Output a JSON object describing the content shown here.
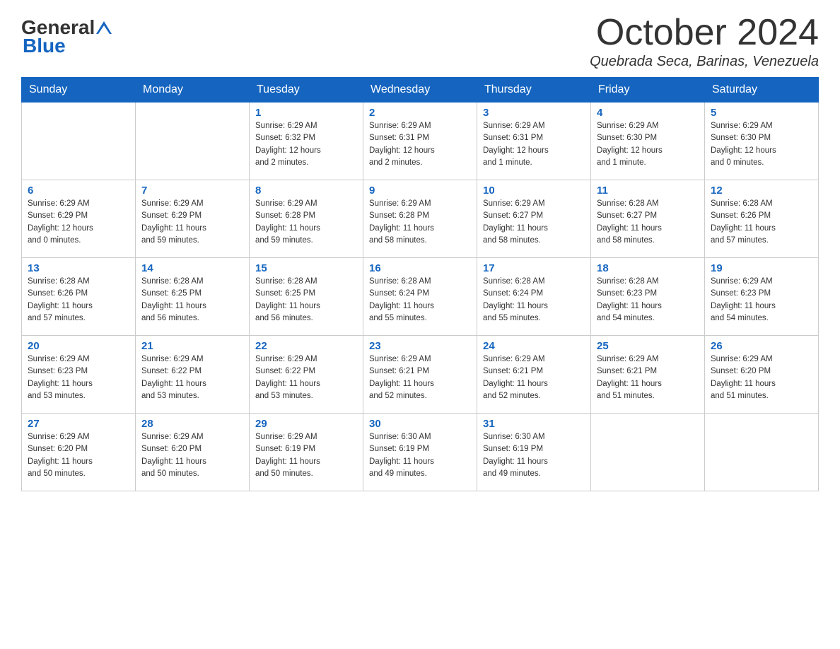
{
  "header": {
    "logo_general": "General",
    "logo_blue": "Blue",
    "month_title": "October 2024",
    "location": "Quebrada Seca, Barinas, Venezuela"
  },
  "days_of_week": [
    "Sunday",
    "Monday",
    "Tuesday",
    "Wednesday",
    "Thursday",
    "Friday",
    "Saturday"
  ],
  "weeks": [
    [
      {
        "day": "",
        "info": ""
      },
      {
        "day": "",
        "info": ""
      },
      {
        "day": "1",
        "info": "Sunrise: 6:29 AM\nSunset: 6:32 PM\nDaylight: 12 hours\nand 2 minutes."
      },
      {
        "day": "2",
        "info": "Sunrise: 6:29 AM\nSunset: 6:31 PM\nDaylight: 12 hours\nand 2 minutes."
      },
      {
        "day": "3",
        "info": "Sunrise: 6:29 AM\nSunset: 6:31 PM\nDaylight: 12 hours\nand 1 minute."
      },
      {
        "day": "4",
        "info": "Sunrise: 6:29 AM\nSunset: 6:30 PM\nDaylight: 12 hours\nand 1 minute."
      },
      {
        "day": "5",
        "info": "Sunrise: 6:29 AM\nSunset: 6:30 PM\nDaylight: 12 hours\nand 0 minutes."
      }
    ],
    [
      {
        "day": "6",
        "info": "Sunrise: 6:29 AM\nSunset: 6:29 PM\nDaylight: 12 hours\nand 0 minutes."
      },
      {
        "day": "7",
        "info": "Sunrise: 6:29 AM\nSunset: 6:29 PM\nDaylight: 11 hours\nand 59 minutes."
      },
      {
        "day": "8",
        "info": "Sunrise: 6:29 AM\nSunset: 6:28 PM\nDaylight: 11 hours\nand 59 minutes."
      },
      {
        "day": "9",
        "info": "Sunrise: 6:29 AM\nSunset: 6:28 PM\nDaylight: 11 hours\nand 58 minutes."
      },
      {
        "day": "10",
        "info": "Sunrise: 6:29 AM\nSunset: 6:27 PM\nDaylight: 11 hours\nand 58 minutes."
      },
      {
        "day": "11",
        "info": "Sunrise: 6:28 AM\nSunset: 6:27 PM\nDaylight: 11 hours\nand 58 minutes."
      },
      {
        "day": "12",
        "info": "Sunrise: 6:28 AM\nSunset: 6:26 PM\nDaylight: 11 hours\nand 57 minutes."
      }
    ],
    [
      {
        "day": "13",
        "info": "Sunrise: 6:28 AM\nSunset: 6:26 PM\nDaylight: 11 hours\nand 57 minutes."
      },
      {
        "day": "14",
        "info": "Sunrise: 6:28 AM\nSunset: 6:25 PM\nDaylight: 11 hours\nand 56 minutes."
      },
      {
        "day": "15",
        "info": "Sunrise: 6:28 AM\nSunset: 6:25 PM\nDaylight: 11 hours\nand 56 minutes."
      },
      {
        "day": "16",
        "info": "Sunrise: 6:28 AM\nSunset: 6:24 PM\nDaylight: 11 hours\nand 55 minutes."
      },
      {
        "day": "17",
        "info": "Sunrise: 6:28 AM\nSunset: 6:24 PM\nDaylight: 11 hours\nand 55 minutes."
      },
      {
        "day": "18",
        "info": "Sunrise: 6:28 AM\nSunset: 6:23 PM\nDaylight: 11 hours\nand 54 minutes."
      },
      {
        "day": "19",
        "info": "Sunrise: 6:29 AM\nSunset: 6:23 PM\nDaylight: 11 hours\nand 54 minutes."
      }
    ],
    [
      {
        "day": "20",
        "info": "Sunrise: 6:29 AM\nSunset: 6:23 PM\nDaylight: 11 hours\nand 53 minutes."
      },
      {
        "day": "21",
        "info": "Sunrise: 6:29 AM\nSunset: 6:22 PM\nDaylight: 11 hours\nand 53 minutes."
      },
      {
        "day": "22",
        "info": "Sunrise: 6:29 AM\nSunset: 6:22 PM\nDaylight: 11 hours\nand 53 minutes."
      },
      {
        "day": "23",
        "info": "Sunrise: 6:29 AM\nSunset: 6:21 PM\nDaylight: 11 hours\nand 52 minutes."
      },
      {
        "day": "24",
        "info": "Sunrise: 6:29 AM\nSunset: 6:21 PM\nDaylight: 11 hours\nand 52 minutes."
      },
      {
        "day": "25",
        "info": "Sunrise: 6:29 AM\nSunset: 6:21 PM\nDaylight: 11 hours\nand 51 minutes."
      },
      {
        "day": "26",
        "info": "Sunrise: 6:29 AM\nSunset: 6:20 PM\nDaylight: 11 hours\nand 51 minutes."
      }
    ],
    [
      {
        "day": "27",
        "info": "Sunrise: 6:29 AM\nSunset: 6:20 PM\nDaylight: 11 hours\nand 50 minutes."
      },
      {
        "day": "28",
        "info": "Sunrise: 6:29 AM\nSunset: 6:20 PM\nDaylight: 11 hours\nand 50 minutes."
      },
      {
        "day": "29",
        "info": "Sunrise: 6:29 AM\nSunset: 6:19 PM\nDaylight: 11 hours\nand 50 minutes."
      },
      {
        "day": "30",
        "info": "Sunrise: 6:30 AM\nSunset: 6:19 PM\nDaylight: 11 hours\nand 49 minutes."
      },
      {
        "day": "31",
        "info": "Sunrise: 6:30 AM\nSunset: 6:19 PM\nDaylight: 11 hours\nand 49 minutes."
      },
      {
        "day": "",
        "info": ""
      },
      {
        "day": "",
        "info": ""
      }
    ]
  ]
}
